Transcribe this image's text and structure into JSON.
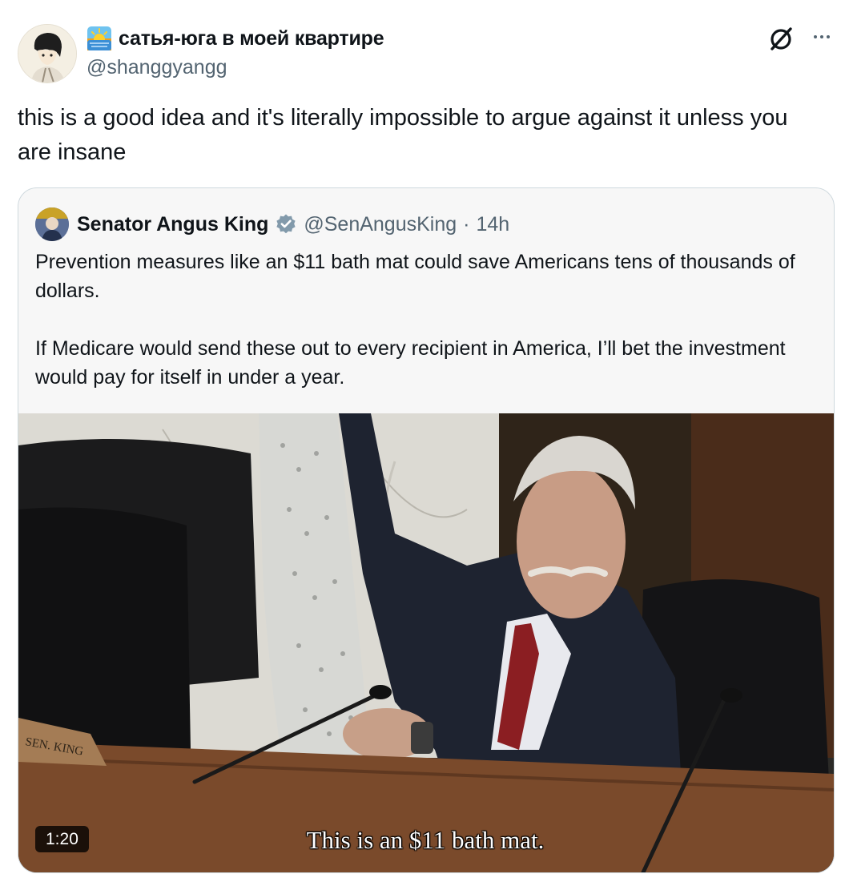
{
  "post": {
    "display_name": "сатья-юга в моей квартире",
    "handle": "@shanggyangg",
    "text": "this is a good idea and it's literally impossible to argue against it unless you are insane",
    "header_icons": [
      "sunrise-emoji-icon",
      "grok-icon",
      "more-icon"
    ]
  },
  "quote": {
    "name": "Senator Angus King",
    "verified": true,
    "handle": "@SenAngusKing",
    "separator": "·",
    "time": "14h",
    "paragraphs": [
      "Prevention measures like an $11 bath mat could save Americans tens of thousands of dollars.",
      "If Medicare would send these out to every recipient in America, I’ll bet the investment would pay for itself in under a year."
    ],
    "video": {
      "duration": "1:20",
      "caption": "This is an $11 bath mat.",
      "nameplate": "SEN. KING"
    }
  },
  "colors": {
    "text": "#0f1419",
    "secondary": "#536471",
    "verified": "#829aab",
    "card_background": "#f7f7f7",
    "border": "#cfd9de"
  }
}
